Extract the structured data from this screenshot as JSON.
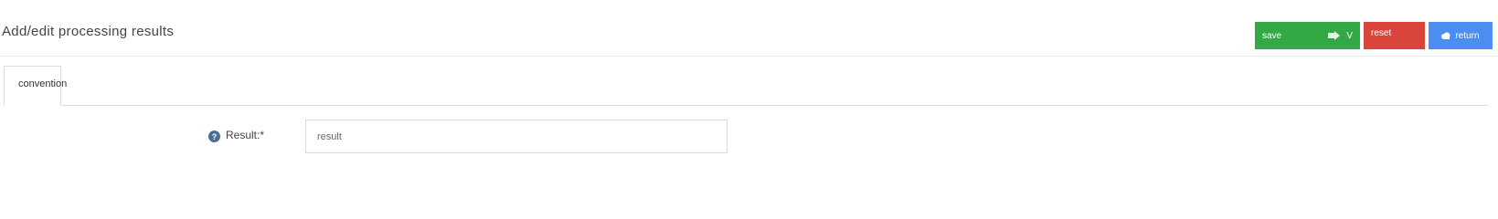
{
  "header": {
    "title": "Add/edit processing results"
  },
  "toolbar": {
    "save_label": "save",
    "save_suffix": "V",
    "reset_label": "reset",
    "return_label": "return"
  },
  "colors": {
    "save": "#32a944",
    "reset": "#d9453a",
    "return": "#4b8df0",
    "help_icon": "#4a6f92"
  },
  "icons": {
    "save_extra": "export-icon",
    "return": "cloud-icon",
    "field_help": "help-icon"
  },
  "tabs": [
    {
      "label": "convention",
      "active": true
    }
  ],
  "form": {
    "result": {
      "label": "Result:*",
      "value": "",
      "placeholder": "result"
    }
  }
}
